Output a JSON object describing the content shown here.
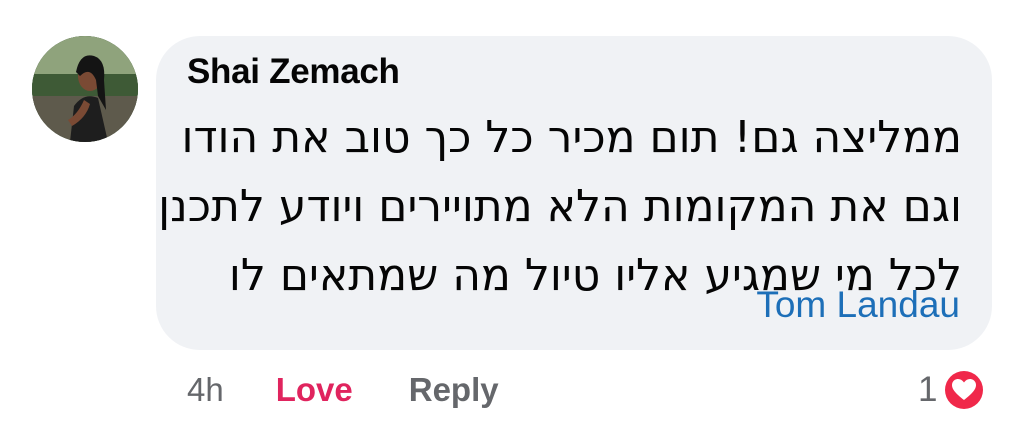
{
  "comment": {
    "author": "Shai Zemach",
    "text_lines": [
      "ממליצה גם! תום מכיר כל כך טוב את הודו",
      "וגם את המקומות הלא מתויירים ויודע לתכנן",
      "לכל מי שמגיע אליו טיול מה שמתאים לו"
    ],
    "mention": "Tom Landau"
  },
  "actions": {
    "time": "4h",
    "love_label": "Love",
    "reply_label": "Reply"
  },
  "reactions": {
    "count": "1",
    "icon": "heart-icon",
    "color": "#f0284a"
  },
  "colors": {
    "bubble": "#f0f2f5",
    "mention": "#1d6fb8",
    "love": "#e0245e",
    "secondary": "#65676b"
  }
}
